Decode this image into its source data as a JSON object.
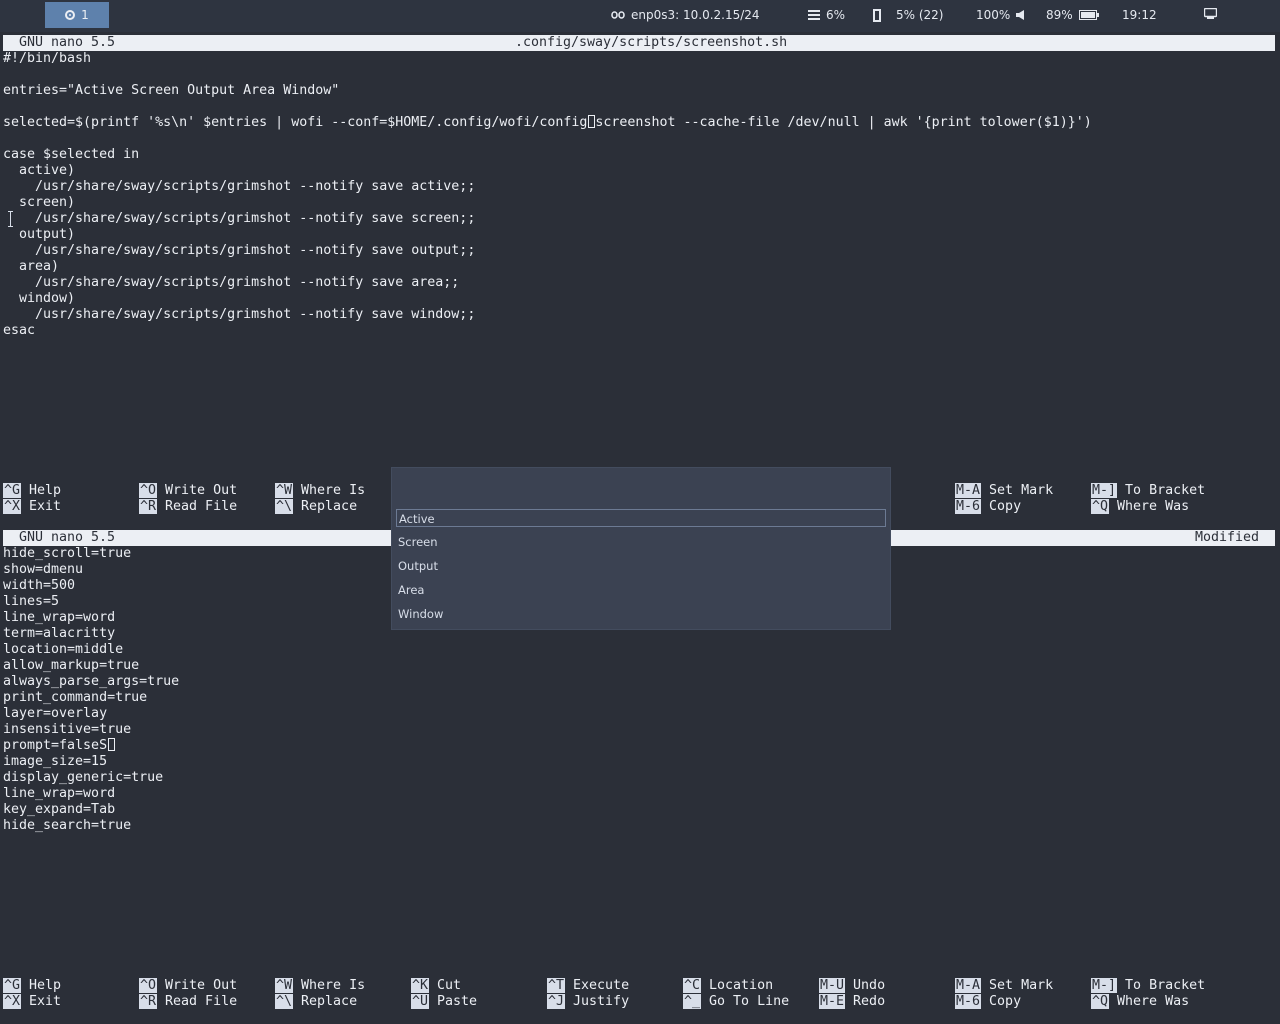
{
  "topbar": {
    "workspace": "1",
    "network": "enp0s3: 10.0.2.15/24",
    "cpu": "6%",
    "memory": "5% (22)",
    "volume": "100%",
    "battery": "89%",
    "clock": "19:12",
    "colors": {
      "workspace_active": "#5e81ac",
      "bar_bg": "#2e3440"
    }
  },
  "editor_top": {
    "program": "GNU nano 5.5",
    "filename": ".config/sway/scripts/screenshot.sh",
    "lines": [
      "#!/bin/bash",
      "",
      "entries=\"Active Screen Output Area Window\"",
      "",
      "selected=$(printf '%s\\n' $entries | wofi --conf=$HOME/.config/wofi/config",
      "",
      "case $selected in",
      "  active)",
      "    /usr/share/sway/scripts/grimshot --notify save active;;",
      "  screen)",
      "    /usr/share/sway/scripts/grimshot --notify save screen;;",
      "  output)",
      "    /usr/share/sway/scripts/grimshot --notify save output;;",
      "  area)",
      "    /usr/share/sway/scripts/grimshot --notify save area;;",
      "  window)",
      "    /usr/share/sway/scripts/grimshot --notify save window;;",
      "esac"
    ],
    "line5_tail": "screenshot --cache-file /dev/null | awk '{print tolower($1)}')"
  },
  "editor_bottom": {
    "program": "GNU nano 5.5",
    "status": "Modified",
    "lines": [
      "hide_scroll=true",
      "show=dmenu",
      "width=500",
      "lines=5",
      "line_wrap=word",
      "term=alacritty",
      "location=middle",
      "allow_markup=true",
      "always_parse_args=true",
      "print_command=true",
      "layer=overlay",
      "insensitive=true",
      "prompt=falseS",
      "image_size=15",
      "display_generic=true",
      "line_wrap=word",
      "key_expand=Tab",
      "hide_search=true"
    ]
  },
  "shortcuts": [
    {
      "k1": "^G",
      "l1": "Help",
      "k2": "^X",
      "l2": "Exit"
    },
    {
      "k1": "^O",
      "l1": "Write Out",
      "k2": "^R",
      "l2": "Read File"
    },
    {
      "k1": "^W",
      "l1": "Where Is",
      "k2": "^\\",
      "l2": "Replace"
    },
    {
      "k1": "^K",
      "l1": "Cut",
      "k2": "^U",
      "l2": "Paste"
    },
    {
      "k1": "^T",
      "l1": "Execute",
      "k2": "^J",
      "l2": "Justify"
    },
    {
      "k1": "^C",
      "l1": "Location",
      "k2": "^_",
      "l2": "Go To Line"
    },
    {
      "k1": "M-U",
      "l1": "Undo",
      "k2": "M-E",
      "l2": "Redo"
    },
    {
      "k1": "M-A",
      "l1": "Set Mark",
      "k2": "M-6",
      "l2": "Copy"
    },
    {
      "k1": "M-]",
      "l1": "To Bracket",
      "k2": "^Q",
      "l2": "Where Was"
    }
  ],
  "wofi": {
    "items": [
      "Active",
      "Screen",
      "Output",
      "Area",
      "Window"
    ],
    "selected": "Active"
  }
}
